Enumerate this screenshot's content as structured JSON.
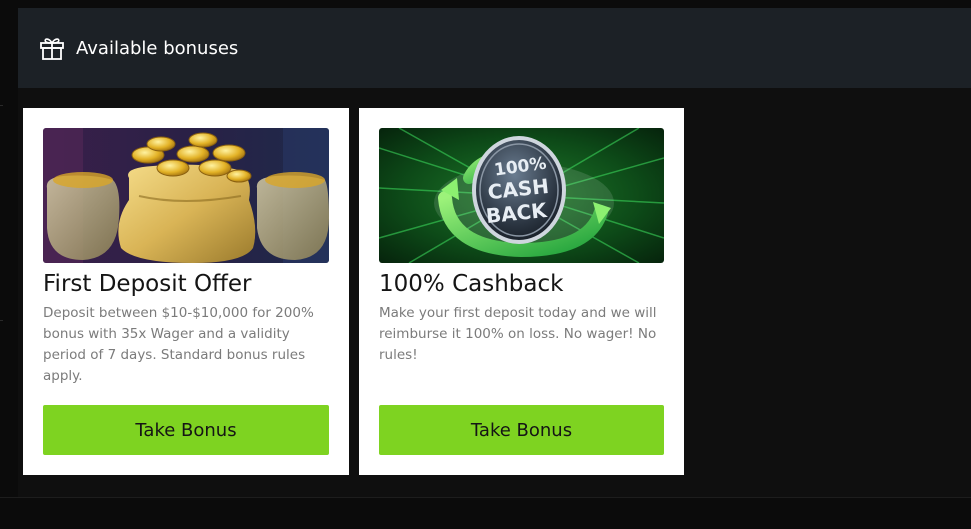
{
  "header": {
    "title": "Available bonuses",
    "icon": "gift-icon"
  },
  "colors": {
    "header_bg": "#1c2126",
    "page_bg": "#0b0b0b",
    "card_bg": "#ffffff",
    "button_green": "#7ed321",
    "title_text": "#151515",
    "desc_text": "#7b7b7b"
  },
  "bonuses": [
    {
      "title": "First Deposit Offer",
      "description": "Deposit between $10-$10,000 for 200% bonus with 35x Wager and a validity period of 7 days. Standard bonus rules apply.",
      "button_label": "Take Bonus",
      "image": "gold-coin-bag-image"
    },
    {
      "title": "100% Cashback",
      "description": "Make your first deposit today and we will reimburse it 100% on loss. No wager! No rules!",
      "button_label": "Take Bonus",
      "image": "cashback-coin-image",
      "image_text": [
        "100%",
        "CASH",
        "BACK"
      ]
    }
  ]
}
